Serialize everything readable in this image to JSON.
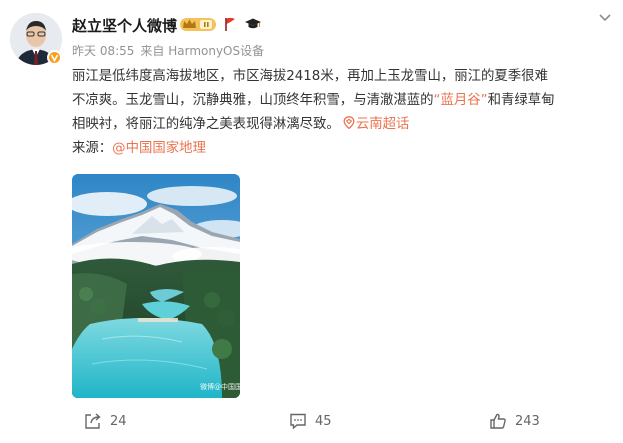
{
  "author": {
    "name": "赵立坚个人微博",
    "avatar_icon": "avatar-photo",
    "verified_icon": "verified-badge-icon",
    "badges": [
      "crown-level-badge-icon",
      "red-flag-icon",
      "graduation-cap-icon"
    ]
  },
  "meta": {
    "time": "昨天 08:55",
    "source": "来自 HarmonyOS设备"
  },
  "post": {
    "line1": "丽江是低纬度高海拔地区，市区海拔2418米，再加上玉龙雪山，丽江的夏季很难",
    "line2": "不凉爽。玉龙雪山，沉静典雅，山顶终年积雪，与清澈湛蓝的",
    "highlight": "“蓝月谷”",
    "line2_after": "和青绿草甸",
    "line3": "相映衬，将丽江的纯净之美表现得淋漓尽致。",
    "topic": "云南超话",
    "source_label": "来源：",
    "source_link": "@中国国家地理"
  },
  "image": {
    "alt_icon": "landscape-photo",
    "watermark": "微博@中国国家地理"
  },
  "actions": {
    "repost_count": "24",
    "comment_count": "45",
    "like_count": "243"
  },
  "colors": {
    "link": "#eb7350",
    "meta": "#939393",
    "text": "#333333"
  }
}
